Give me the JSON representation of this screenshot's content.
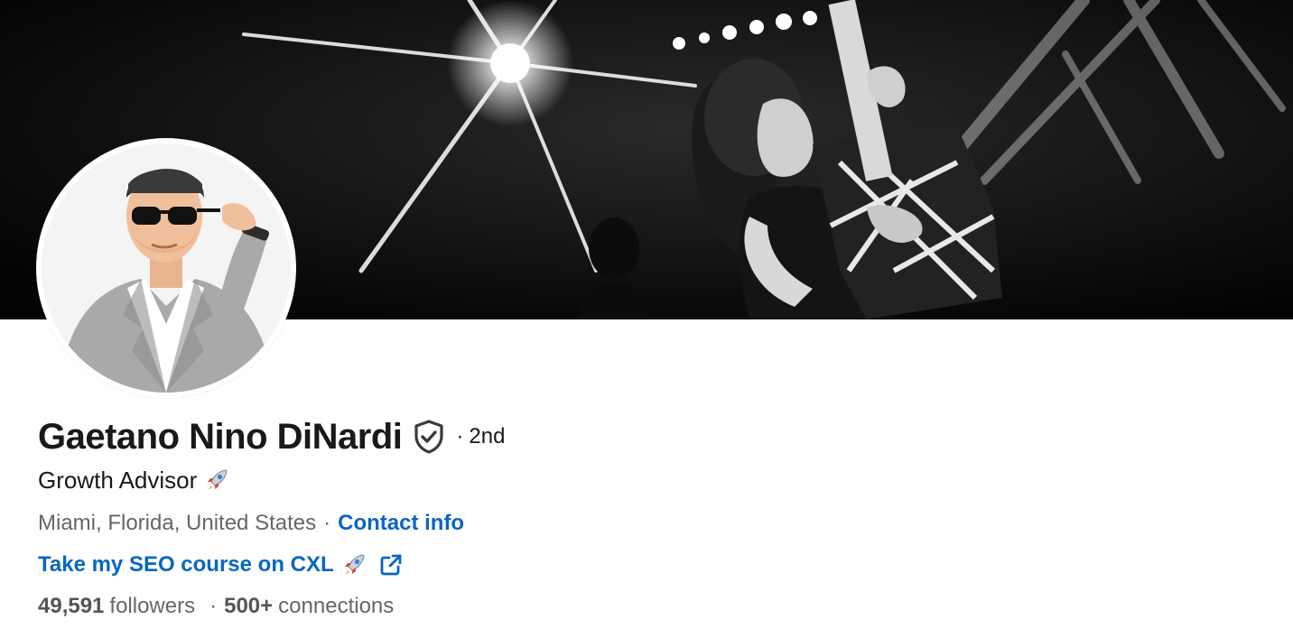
{
  "profile": {
    "name": "Gaetano Nino DiNardi",
    "degree_separator": "·",
    "degree": "2nd",
    "headline": "Growth Advisor",
    "location": "Miami, Florida, United States",
    "location_separator": "·",
    "contact_info_label": "Contact info",
    "external_link_label": "Take my SEO course on CXL",
    "followers_count": "49,591",
    "followers_label": "followers",
    "stats_separator": "·",
    "connections_count": "500+",
    "connections_label": "connections"
  },
  "icons": {
    "verified": "shield-check-icon",
    "headline_emoji": "rocket-icon",
    "link_emoji": "rocket-icon",
    "external": "external-link-icon"
  },
  "colors": {
    "link_blue": "#0a66c2",
    "text_primary": "#191919",
    "text_secondary": "#666666",
    "banner_bg": "#050505"
  }
}
